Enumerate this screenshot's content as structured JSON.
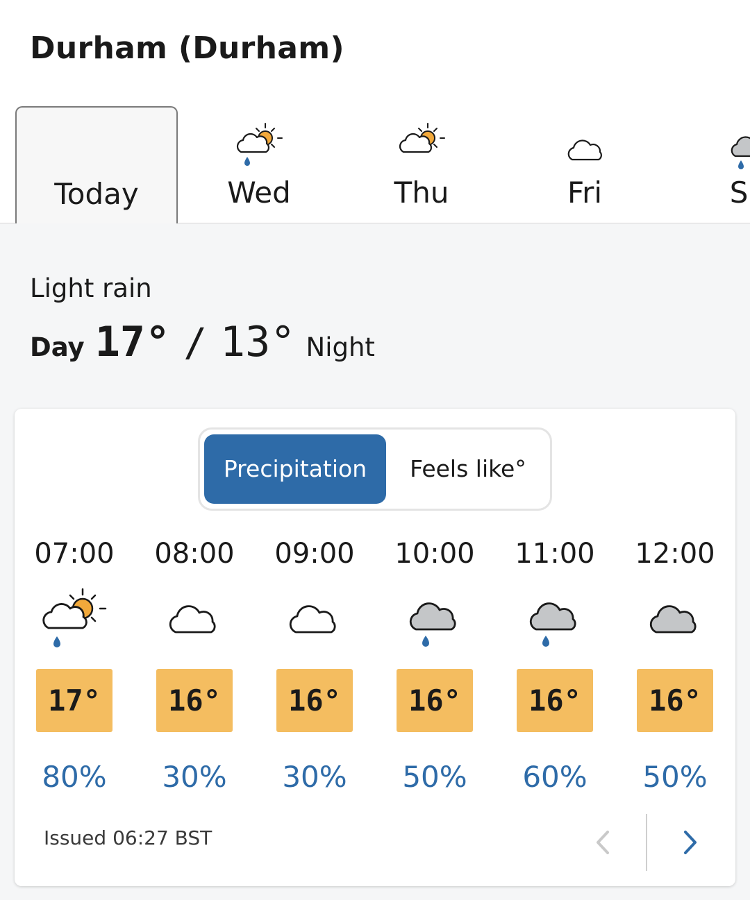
{
  "location": {
    "title": "Durham (Durham)"
  },
  "day_tabs": [
    {
      "label": "Today",
      "icon": "none",
      "selected": true
    },
    {
      "label": "Wed",
      "icon": "sunny-intervals-light-rain-icon",
      "selected": false
    },
    {
      "label": "Thu",
      "icon": "sunny-intervals-icon",
      "selected": false
    },
    {
      "label": "Fri",
      "icon": "cloudy-icon",
      "selected": false
    },
    {
      "label": "Sa",
      "icon": "overcast-light-rain-icon",
      "selected": false
    }
  ],
  "summary": {
    "condition": "Light rain",
    "day_label": "Day",
    "day_temp": "17°",
    "separator": "/",
    "night_temp": "13°",
    "night_label": "Night"
  },
  "toggle": {
    "options": [
      "Precipitation",
      "Feels like°"
    ],
    "active": "Precipitation"
  },
  "hourly": [
    {
      "time": "07:00",
      "icon": "sunny-intervals-light-rain-icon",
      "temp": "17°",
      "precip": "80%"
    },
    {
      "time": "08:00",
      "icon": "cloudy-icon",
      "temp": "16°",
      "precip": "30%"
    },
    {
      "time": "09:00",
      "icon": "cloudy-icon",
      "temp": "16°",
      "precip": "30%"
    },
    {
      "time": "10:00",
      "icon": "overcast-light-rain-icon",
      "temp": "16°",
      "precip": "50%"
    },
    {
      "time": "11:00",
      "icon": "overcast-light-rain-icon",
      "temp": "16°",
      "precip": "60%"
    },
    {
      "time": "12:00",
      "icon": "overcast-icon",
      "temp": "16°",
      "precip": "50%"
    }
  ],
  "footer": {
    "issued": "Issued 06:27 BST"
  },
  "colors": {
    "accent_blue": "#2e6ba8",
    "temp_box": "#f4bd60",
    "sun": "#f2a93b",
    "rain_drop": "#2e6ba8",
    "cloud_grey": "#c4c6c8"
  }
}
